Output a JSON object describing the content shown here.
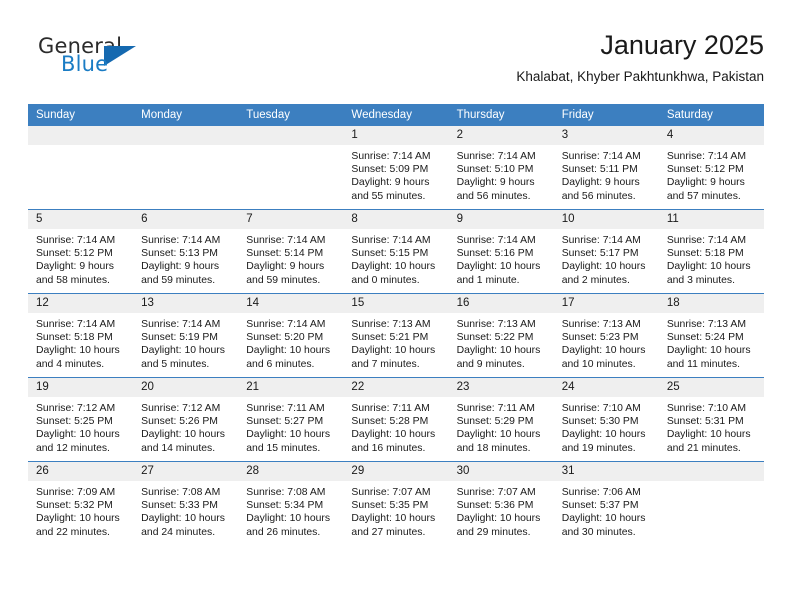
{
  "brand": {
    "name_top": "General",
    "name_bottom": "Blue",
    "accent_color": "#1569b0",
    "text_color": "#2b2b2b"
  },
  "header": {
    "title": "January 2025",
    "subtitle": "Khalabat, Khyber Pakhtunkhwa, Pakistan"
  },
  "calendar": {
    "header_bg": "#3c7fc0",
    "daynum_bg": "#efefef",
    "weekday_headers": [
      "Sunday",
      "Monday",
      "Tuesday",
      "Wednesday",
      "Thursday",
      "Friday",
      "Saturday"
    ],
    "weeks": [
      [
        {
          "day": "",
          "sunrise": "",
          "sunset": "",
          "daylight_line1": "",
          "daylight_line2": ""
        },
        {
          "day": "",
          "sunrise": "",
          "sunset": "",
          "daylight_line1": "",
          "daylight_line2": ""
        },
        {
          "day": "",
          "sunrise": "",
          "sunset": "",
          "daylight_line1": "",
          "daylight_line2": ""
        },
        {
          "day": "1",
          "sunrise": "Sunrise: 7:14 AM",
          "sunset": "Sunset: 5:09 PM",
          "daylight_line1": "Daylight: 9 hours",
          "daylight_line2": "and 55 minutes."
        },
        {
          "day": "2",
          "sunrise": "Sunrise: 7:14 AM",
          "sunset": "Sunset: 5:10 PM",
          "daylight_line1": "Daylight: 9 hours",
          "daylight_line2": "and 56 minutes."
        },
        {
          "day": "3",
          "sunrise": "Sunrise: 7:14 AM",
          "sunset": "Sunset: 5:11 PM",
          "daylight_line1": "Daylight: 9 hours",
          "daylight_line2": "and 56 minutes."
        },
        {
          "day": "4",
          "sunrise": "Sunrise: 7:14 AM",
          "sunset": "Sunset: 5:12 PM",
          "daylight_line1": "Daylight: 9 hours",
          "daylight_line2": "and 57 minutes."
        }
      ],
      [
        {
          "day": "5",
          "sunrise": "Sunrise: 7:14 AM",
          "sunset": "Sunset: 5:12 PM",
          "daylight_line1": "Daylight: 9 hours",
          "daylight_line2": "and 58 minutes."
        },
        {
          "day": "6",
          "sunrise": "Sunrise: 7:14 AM",
          "sunset": "Sunset: 5:13 PM",
          "daylight_line1": "Daylight: 9 hours",
          "daylight_line2": "and 59 minutes."
        },
        {
          "day": "7",
          "sunrise": "Sunrise: 7:14 AM",
          "sunset": "Sunset: 5:14 PM",
          "daylight_line1": "Daylight: 9 hours",
          "daylight_line2": "and 59 minutes."
        },
        {
          "day": "8",
          "sunrise": "Sunrise: 7:14 AM",
          "sunset": "Sunset: 5:15 PM",
          "daylight_line1": "Daylight: 10 hours",
          "daylight_line2": "and 0 minutes."
        },
        {
          "day": "9",
          "sunrise": "Sunrise: 7:14 AM",
          "sunset": "Sunset: 5:16 PM",
          "daylight_line1": "Daylight: 10 hours",
          "daylight_line2": "and 1 minute."
        },
        {
          "day": "10",
          "sunrise": "Sunrise: 7:14 AM",
          "sunset": "Sunset: 5:17 PM",
          "daylight_line1": "Daylight: 10 hours",
          "daylight_line2": "and 2 minutes."
        },
        {
          "day": "11",
          "sunrise": "Sunrise: 7:14 AM",
          "sunset": "Sunset: 5:18 PM",
          "daylight_line1": "Daylight: 10 hours",
          "daylight_line2": "and 3 minutes."
        }
      ],
      [
        {
          "day": "12",
          "sunrise": "Sunrise: 7:14 AM",
          "sunset": "Sunset: 5:18 PM",
          "daylight_line1": "Daylight: 10 hours",
          "daylight_line2": "and 4 minutes."
        },
        {
          "day": "13",
          "sunrise": "Sunrise: 7:14 AM",
          "sunset": "Sunset: 5:19 PM",
          "daylight_line1": "Daylight: 10 hours",
          "daylight_line2": "and 5 minutes."
        },
        {
          "day": "14",
          "sunrise": "Sunrise: 7:14 AM",
          "sunset": "Sunset: 5:20 PM",
          "daylight_line1": "Daylight: 10 hours",
          "daylight_line2": "and 6 minutes."
        },
        {
          "day": "15",
          "sunrise": "Sunrise: 7:13 AM",
          "sunset": "Sunset: 5:21 PM",
          "daylight_line1": "Daylight: 10 hours",
          "daylight_line2": "and 7 minutes."
        },
        {
          "day": "16",
          "sunrise": "Sunrise: 7:13 AM",
          "sunset": "Sunset: 5:22 PM",
          "daylight_line1": "Daylight: 10 hours",
          "daylight_line2": "and 9 minutes."
        },
        {
          "day": "17",
          "sunrise": "Sunrise: 7:13 AM",
          "sunset": "Sunset: 5:23 PM",
          "daylight_line1": "Daylight: 10 hours",
          "daylight_line2": "and 10 minutes."
        },
        {
          "day": "18",
          "sunrise": "Sunrise: 7:13 AM",
          "sunset": "Sunset: 5:24 PM",
          "daylight_line1": "Daylight: 10 hours",
          "daylight_line2": "and 11 minutes."
        }
      ],
      [
        {
          "day": "19",
          "sunrise": "Sunrise: 7:12 AM",
          "sunset": "Sunset: 5:25 PM",
          "daylight_line1": "Daylight: 10 hours",
          "daylight_line2": "and 12 minutes."
        },
        {
          "day": "20",
          "sunrise": "Sunrise: 7:12 AM",
          "sunset": "Sunset: 5:26 PM",
          "daylight_line1": "Daylight: 10 hours",
          "daylight_line2": "and 14 minutes."
        },
        {
          "day": "21",
          "sunrise": "Sunrise: 7:11 AM",
          "sunset": "Sunset: 5:27 PM",
          "daylight_line1": "Daylight: 10 hours",
          "daylight_line2": "and 15 minutes."
        },
        {
          "day": "22",
          "sunrise": "Sunrise: 7:11 AM",
          "sunset": "Sunset: 5:28 PM",
          "daylight_line1": "Daylight: 10 hours",
          "daylight_line2": "and 16 minutes."
        },
        {
          "day": "23",
          "sunrise": "Sunrise: 7:11 AM",
          "sunset": "Sunset: 5:29 PM",
          "daylight_line1": "Daylight: 10 hours",
          "daylight_line2": "and 18 minutes."
        },
        {
          "day": "24",
          "sunrise": "Sunrise: 7:10 AM",
          "sunset": "Sunset: 5:30 PM",
          "daylight_line1": "Daylight: 10 hours",
          "daylight_line2": "and 19 minutes."
        },
        {
          "day": "25",
          "sunrise": "Sunrise: 7:10 AM",
          "sunset": "Sunset: 5:31 PM",
          "daylight_line1": "Daylight: 10 hours",
          "daylight_line2": "and 21 minutes."
        }
      ],
      [
        {
          "day": "26",
          "sunrise": "Sunrise: 7:09 AM",
          "sunset": "Sunset: 5:32 PM",
          "daylight_line1": "Daylight: 10 hours",
          "daylight_line2": "and 22 minutes."
        },
        {
          "day": "27",
          "sunrise": "Sunrise: 7:08 AM",
          "sunset": "Sunset: 5:33 PM",
          "daylight_line1": "Daylight: 10 hours",
          "daylight_line2": "and 24 minutes."
        },
        {
          "day": "28",
          "sunrise": "Sunrise: 7:08 AM",
          "sunset": "Sunset: 5:34 PM",
          "daylight_line1": "Daylight: 10 hours",
          "daylight_line2": "and 26 minutes."
        },
        {
          "day": "29",
          "sunrise": "Sunrise: 7:07 AM",
          "sunset": "Sunset: 5:35 PM",
          "daylight_line1": "Daylight: 10 hours",
          "daylight_line2": "and 27 minutes."
        },
        {
          "day": "30",
          "sunrise": "Sunrise: 7:07 AM",
          "sunset": "Sunset: 5:36 PM",
          "daylight_line1": "Daylight: 10 hours",
          "daylight_line2": "and 29 minutes."
        },
        {
          "day": "31",
          "sunrise": "Sunrise: 7:06 AM",
          "sunset": "Sunset: 5:37 PM",
          "daylight_line1": "Daylight: 10 hours",
          "daylight_line2": "and 30 minutes."
        },
        {
          "day": "",
          "sunrise": "",
          "sunset": "",
          "daylight_line1": "",
          "daylight_line2": ""
        }
      ]
    ]
  }
}
